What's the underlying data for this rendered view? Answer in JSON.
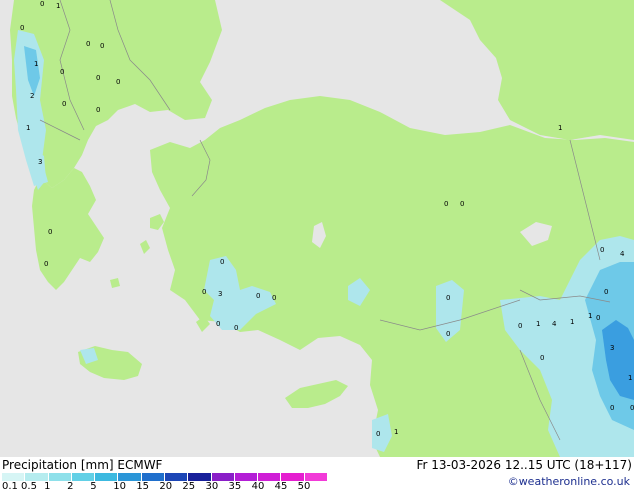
{
  "footer": {
    "title": "Precipitation [mm]  ECMWF",
    "valid_time": "Fr 13-03-2026 12..15 UTC (18+117)",
    "credit": "©weatheronline.co.uk"
  },
  "legend": {
    "labels": [
      "0.1",
      "0.5",
      "1",
      "2",
      "5",
      "10",
      "15",
      "20",
      "25",
      "30",
      "35",
      "40",
      "45",
      "50"
    ],
    "colors": [
      "#d6f5f5",
      "#b5ecef",
      "#8ee0ea",
      "#62d0e6",
      "#3cb9e0",
      "#2b96d8",
      "#1f6fcc",
      "#1c46b6",
      "#18209a",
      "#8a1ec8",
      "#b31ed6",
      "#cf1ed6",
      "#e51ed0",
      "#f23ad8"
    ]
  },
  "colors": {
    "sea": "#e6e6e6",
    "land_forecast": "#b9ec8c",
    "land_outside": "#e6e6e6",
    "precip_light": "#aee6ec",
    "precip_mid": "#6ec9e8",
    "precip_heavy": "#3a9ee0",
    "border": "#8a8a8a"
  },
  "map_labels": [
    {
      "text": "0"
    },
    {
      "text": "1"
    },
    {
      "text": "0"
    },
    {
      "text": "1"
    },
    {
      "text": "0"
    },
    {
      "text": "0"
    },
    {
      "text": "2"
    },
    {
      "text": "0"
    },
    {
      "text": "0"
    },
    {
      "text": "0"
    },
    {
      "text": "1"
    },
    {
      "text": "3"
    },
    {
      "text": "0"
    },
    {
      "text": "0"
    },
    {
      "text": "0"
    },
    {
      "text": "0"
    },
    {
      "text": "0"
    },
    {
      "text": "0"
    },
    {
      "text": "3"
    },
    {
      "text": "0"
    },
    {
      "text": "0"
    },
    {
      "text": "0"
    },
    {
      "text": "0"
    },
    {
      "text": "0"
    },
    {
      "text": "0"
    },
    {
      "text": "0"
    },
    {
      "text": "0"
    },
    {
      "text": "1"
    },
    {
      "text": "0"
    },
    {
      "text": "1"
    },
    {
      "text": "4"
    },
    {
      "text": "1"
    },
    {
      "text": "1"
    },
    {
      "text": "0"
    },
    {
      "text": "4"
    },
    {
      "text": "3"
    },
    {
      "text": "1"
    },
    {
      "text": "0"
    },
    {
      "text": "0"
    },
    {
      "text": "0"
    },
    {
      "text": "0"
    },
    {
      "text": "1"
    },
    {
      "text": "0"
    },
    {
      "text": "0"
    }
  ]
}
